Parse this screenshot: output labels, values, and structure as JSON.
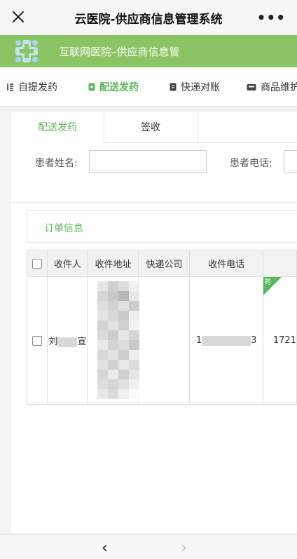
{
  "window": {
    "title": "云医院-供应商信息管理系统",
    "close_icon": "close-icon",
    "more_icon": "more-icon",
    "more_label": "•••"
  },
  "banner": {
    "text": "互联网医院–供应商信息管",
    "bg_color": "#8bc563",
    "logo_icon": "hospital-logo-icon"
  },
  "nav": {
    "items": [
      {
        "label": "自提发药",
        "icon": "self-pickup-icon",
        "active": false
      },
      {
        "label": "配送发药",
        "icon": "delivery-icon",
        "active": true
      },
      {
        "label": "快递对账",
        "icon": "reconcile-icon",
        "active": false
      },
      {
        "label": "商品维护",
        "icon": "goods-icon",
        "active": false
      }
    ],
    "accent": "#5cb85c"
  },
  "tabs": [
    {
      "label": "配送发药",
      "active": true
    },
    {
      "label": "签收",
      "active": false
    }
  ],
  "search": {
    "patient_name_label": "患者姓名:",
    "patient_name_value": "",
    "patient_phone_label": "患者电话:",
    "patient_phone_value": ""
  },
  "order_section": {
    "label": "订单信息"
  },
  "table": {
    "headers": [
      "收件人",
      "收件地址",
      "快递公司",
      "收件电话"
    ],
    "rows": [
      {
        "recipient_start": "刘",
        "recipient_end": "宣",
        "address": "",
        "courier": "",
        "phone_start": "1",
        "phone_end": "3",
        "tag": "药",
        "extra": "1721"
      }
    ]
  },
  "bottom": {
    "back_icon": "chevron-left-icon",
    "forward_icon": "chevron-right-icon",
    "back_label": "‹",
    "forward_label": "›"
  }
}
